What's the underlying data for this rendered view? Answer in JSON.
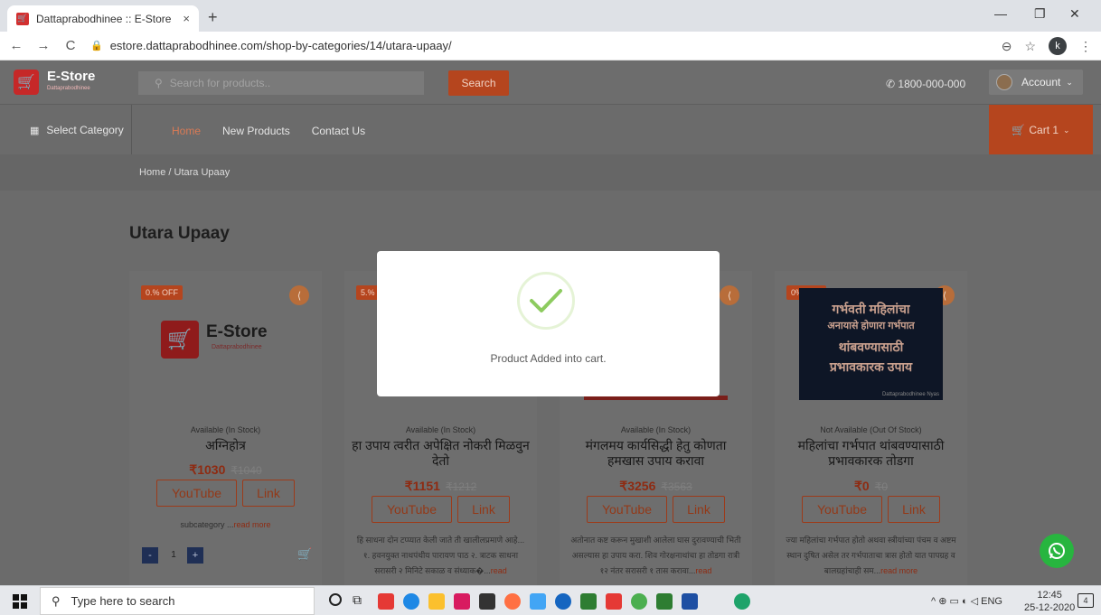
{
  "browser": {
    "tab_title": "Dattaprabodhinee :: E-Store",
    "tab_close": "×",
    "new_tab": "+",
    "url": "estore.dattaprabodhinee.com/shop-by-categories/14/utara-upaay/",
    "profile_initial": "k"
  },
  "header": {
    "logo_title": "E-Store",
    "logo_subtitle": "Dattaprabodhinee",
    "search_placeholder": "Search for products..",
    "search_button": "Search",
    "phone": "1800-000-000",
    "account_label": "Account"
  },
  "nav": {
    "select_category": "Select Category",
    "links": [
      "Home",
      "New Products",
      "Contact Us"
    ],
    "cart_label": "Cart 1"
  },
  "breadcrumb": "Home / Utara Upaay",
  "page_title": "Utara Upaay",
  "products": [
    {
      "badge": "0.% OFF",
      "availability": "Available (In Stock)",
      "name": "अग्निहोत्र",
      "price": "₹1030",
      "old_price": "₹1040",
      "youtube_label": "YouTube",
      "link_label": "Link",
      "description": "subcategory ...",
      "read_more": "read more",
      "qty": "1",
      "logo_title": "E-Store",
      "logo_subtitle": "Dattaprabodhinee"
    },
    {
      "badge": "5.%",
      "availability": "Available (In Stock)",
      "name": "हा उपाय त्वरीत अपेक्षित नोकरी मिळवुन देतो",
      "price": "₹1151",
      "old_price": "₹1212",
      "youtube_label": "YouTube",
      "link_label": "Link",
      "description": "हि साधना दोन टप्प्यात केली जाते ती खालीलप्रमाणे आहे... १. हवनयुक्त नाथपंथीय पारायण पाठ २. त्राटक साधना सरासरी २ मिनिटे सकाळ व संध्याक�...",
      "read_more": "read"
    },
    {
      "availability": "Available (In Stock)",
      "name": "मंगलमय कार्यसिद्धी हेतु कोणता हमखास उपाय करावा",
      "price": "₹3256",
      "old_price": "₹3563",
      "youtube_label": "YouTube",
      "link_label": "Link",
      "description": "अतोनात कष्ट करून मुखाशी आलेला घास दुरावण्याची भिती असल्यास हा उपाय करा. शिव गोरक्षनाथांचा हा तोडगा रात्री १२ नंतर सरासरी १ तास करावा...",
      "read_more": "read"
    },
    {
      "badge": "0% OFF",
      "availability": "Not Available (Out Of Stock)",
      "name": "महिलांचा गर्भपात थांबवण्यासाठी प्रभावकारक तोडगा",
      "price": "₹0",
      "old_price": "₹0",
      "youtube_label": "YouTube",
      "link_label": "Link",
      "description": "ज्या महिलांचा गर्भपात होतो अथवा स्त्रीयांच्या पंचम व अष्टम स्थान दुषित असेल तर गर्भपाताचा त्रास होतो यात पापग्रह व बालग्रहांचाही सम...",
      "read_more": "read more",
      "image_lines": [
        "गर्भवती महिलांचा",
        "अनायासे होणारा गर्भपात",
        "थांबवण्यासाठी",
        "प्रभावकारक उपाय"
      ],
      "image_footer": "Dattaprabodhinee Nyas"
    }
  ],
  "modal": {
    "message": "Product Added into cart."
  },
  "taskbar": {
    "search_placeholder": "Type here to search",
    "tray_lang": "ENG",
    "time": "12:45",
    "date": "25-12-2020",
    "notif_count": "4"
  },
  "colors": {
    "brand_red": "#c62828",
    "accent_orange": "#b5451e",
    "overlay_gray": "#6b6b6b",
    "check_green": "#8dcb5f",
    "whatsapp": "#27b53f"
  }
}
